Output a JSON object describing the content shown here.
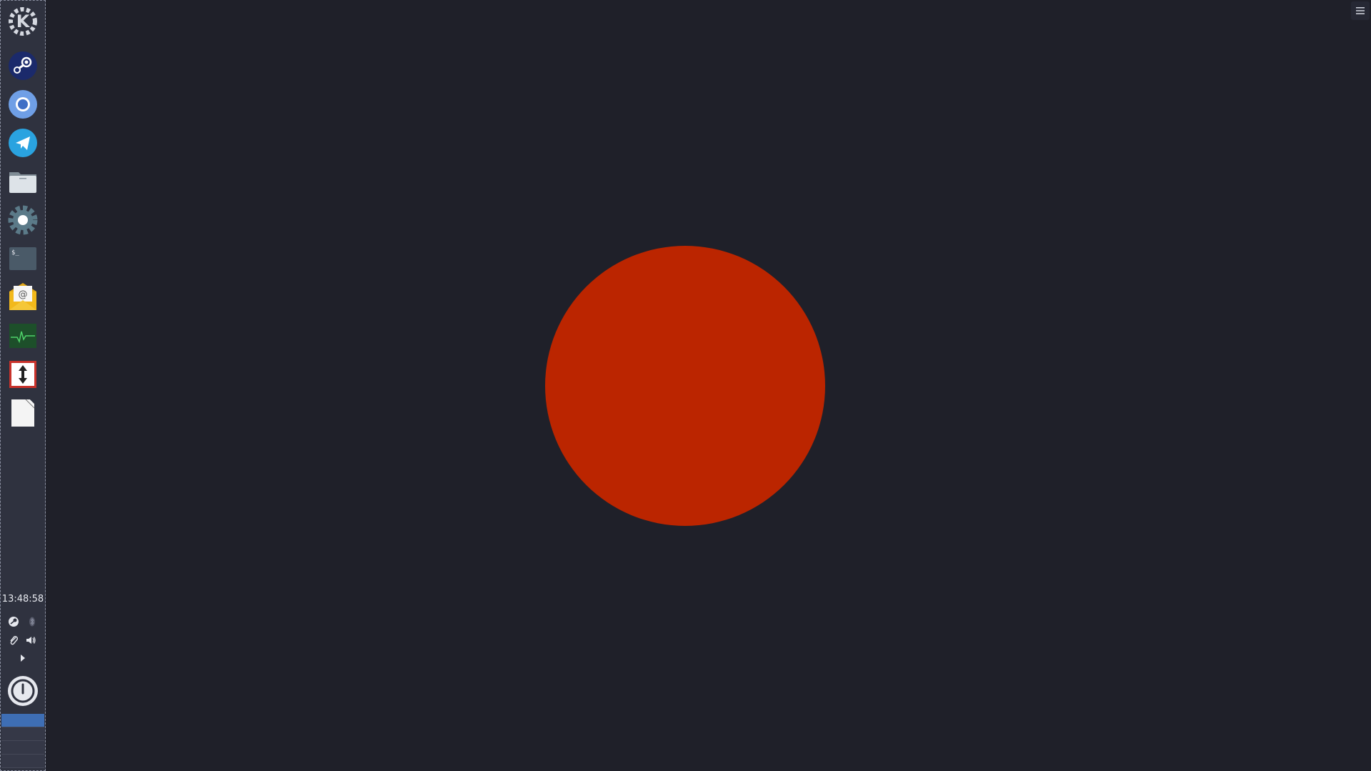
{
  "colors": {
    "desktop_bg": "#1f2029",
    "panel_bg": "#2f323f",
    "circle": "#bb2500",
    "pager_active": "#3e6eb4"
  },
  "panel": {
    "launchers": [
      {
        "id": "kde",
        "icon": "kde-logo-icon"
      },
      {
        "id": "steam",
        "icon": "steam-icon"
      },
      {
        "id": "chromium",
        "icon": "chromium-icon"
      },
      {
        "id": "telegram",
        "icon": "telegram-icon"
      },
      {
        "id": "files",
        "icon": "folder-icon"
      },
      {
        "id": "settings",
        "icon": "gear-icon"
      },
      {
        "id": "terminal",
        "icon": "terminal-icon"
      },
      {
        "id": "mail",
        "icon": "mail-icon"
      },
      {
        "id": "system-monitor",
        "icon": "system-monitor-icon"
      },
      {
        "id": "transfer",
        "icon": "up-down-arrow-icon"
      },
      {
        "id": "document",
        "icon": "document-icon"
      }
    ],
    "clock": "13:48:58",
    "tray": [
      "steam-tray-icon",
      "bluetooth-icon",
      "clipboard-icon",
      "volume-icon"
    ],
    "expander_icon": "chevron-right-icon",
    "power_icon": "power-icon",
    "pager": {
      "desktops": 4,
      "active": 1
    }
  },
  "top_right": {
    "menu_icon": "hamburger-menu-icon"
  },
  "terminal_prompt": "$_"
}
